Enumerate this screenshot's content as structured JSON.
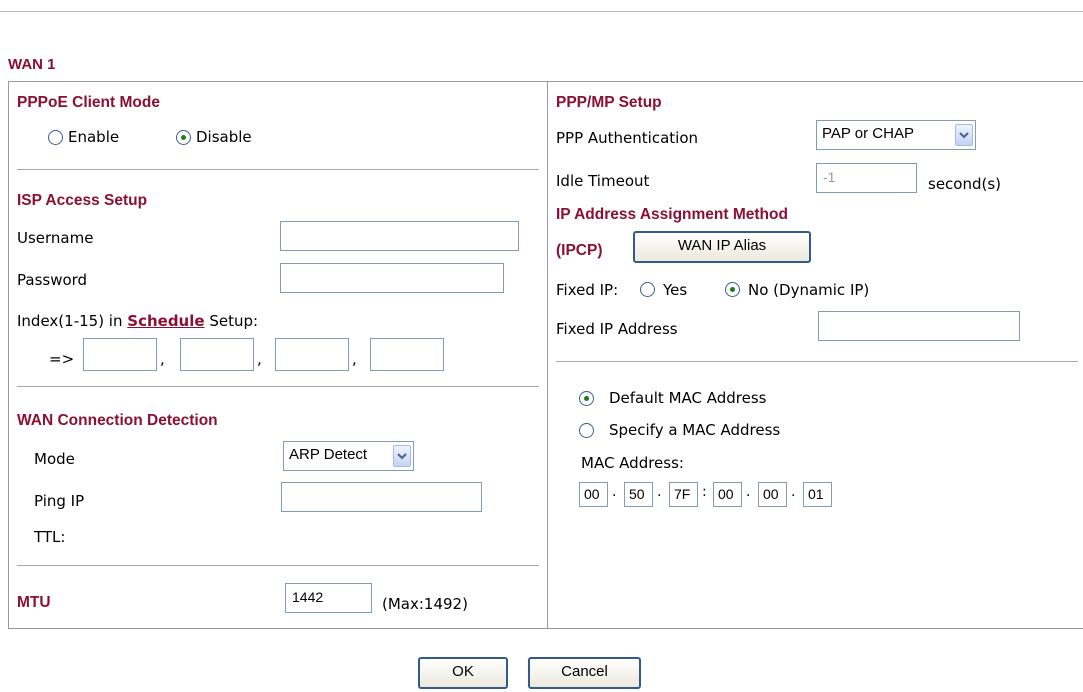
{
  "wan_title": "WAN 1",
  "pppoe": {
    "title": "PPPoE Client Mode",
    "enable_label": "Enable",
    "disable_label": "Disable",
    "selected": "Disable"
  },
  "isp": {
    "title": "ISP Access Setup",
    "username_label": "Username",
    "username_value": "",
    "password_label": "Password",
    "password_value": "",
    "index_prefix": "Index(1-15) in",
    "schedule_link": "Schedule",
    "index_suffix": "Setup:",
    "arrow": "=>",
    "schedule_values": [
      "",
      "",
      "",
      ""
    ]
  },
  "detection": {
    "title": "WAN Connection Detection",
    "mode_label": "Mode",
    "mode_value": "ARP Detect",
    "ping_label": "Ping IP",
    "ping_value": "",
    "ttl_label": "TTL:"
  },
  "mtu": {
    "label": "MTU",
    "value": "1442",
    "max": "(Max:1492)"
  },
  "ppp": {
    "title": "PPP/MP Setup",
    "auth_label": "PPP Authentication",
    "auth_value": "PAP or CHAP",
    "idle_label": "Idle Timeout",
    "idle_value": "-1",
    "idle_unit": "second(s)"
  },
  "ipam": {
    "title": "IP Address Assignment Method",
    "ipcp": "(IPCP)",
    "alias_button": "WAN IP Alias",
    "fixed_label": "Fixed IP:",
    "yes_label": "Yes",
    "no_label": "No (Dynamic IP)",
    "fixed_selected": "No",
    "fixed_addr_label": "Fixed IP Address",
    "fixed_addr_value": ""
  },
  "mac": {
    "default_label": "Default MAC Address",
    "specify_label": "Specify a MAC Address",
    "selected": "Default MAC Address",
    "address_label": "MAC Address:",
    "octets": [
      "00",
      "50",
      "7F",
      "00",
      "00",
      "01"
    ]
  },
  "buttons": {
    "ok": "OK",
    "cancel": "Cancel"
  },
  "colors": {
    "section_title": "#8b1033",
    "input_border": "#7f9db9",
    "button_border": "#325b8a"
  }
}
